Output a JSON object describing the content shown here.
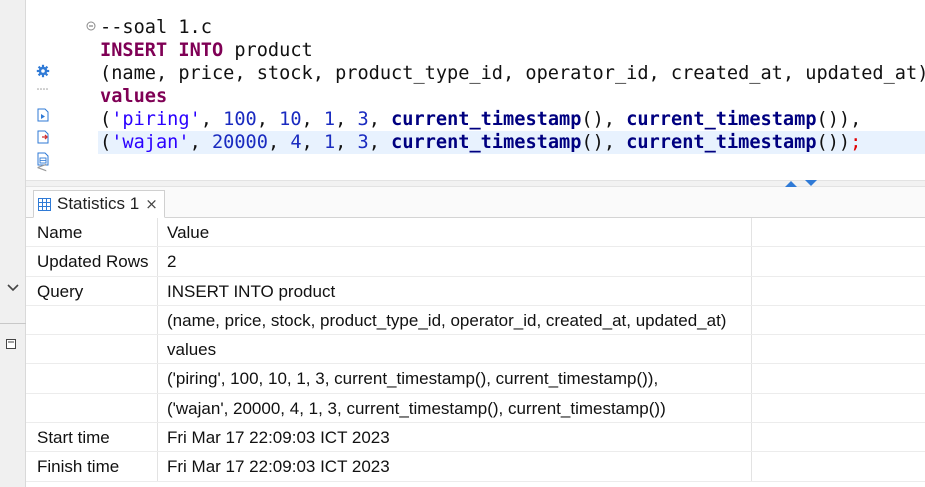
{
  "editor": {
    "code_lines": [
      [
        {
          "t": "--soal 1.c",
          "c": "plain"
        }
      ],
      [
        {
          "t": "INSERT",
          "c": "kw"
        },
        {
          "t": " ",
          "c": "plain"
        },
        {
          "t": "INTO",
          "c": "kw"
        },
        {
          "t": " product",
          "c": "plain"
        }
      ],
      [
        {
          "t": "(name, price, stock, product_type_id, operator_id, created_at, updated_at)",
          "c": "plain"
        }
      ],
      [
        {
          "t": "values",
          "c": "kw"
        }
      ],
      [
        {
          "t": "(",
          "c": "plain"
        },
        {
          "t": "'piring'",
          "c": "str"
        },
        {
          "t": ", ",
          "c": "plain"
        },
        {
          "t": "100",
          "c": "num"
        },
        {
          "t": ", ",
          "c": "plain"
        },
        {
          "t": "10",
          "c": "num"
        },
        {
          "t": ", ",
          "c": "plain"
        },
        {
          "t": "1",
          "c": "num"
        },
        {
          "t": ", ",
          "c": "plain"
        },
        {
          "t": "3",
          "c": "num"
        },
        {
          "t": ", ",
          "c": "plain"
        },
        {
          "t": "current_timestamp",
          "c": "fn"
        },
        {
          "t": "(), ",
          "c": "plain"
        },
        {
          "t": "current_timestamp",
          "c": "fn"
        },
        {
          "t": "()),",
          "c": "plain"
        }
      ],
      [
        {
          "t": "(",
          "c": "plain"
        },
        {
          "t": "'wajan'",
          "c": "str"
        },
        {
          "t": ", ",
          "c": "plain"
        },
        {
          "t": "20000",
          "c": "num"
        },
        {
          "t": ", ",
          "c": "plain"
        },
        {
          "t": "4",
          "c": "num"
        },
        {
          "t": ", ",
          "c": "plain"
        },
        {
          "t": "1",
          "c": "num"
        },
        {
          "t": ", ",
          "c": "plain"
        },
        {
          "t": "3",
          "c": "num"
        },
        {
          "t": ", ",
          "c": "plain"
        },
        {
          "t": "current_timestamp",
          "c": "fn"
        },
        {
          "t": "(), ",
          "c": "plain"
        },
        {
          "t": "current_timestamp",
          "c": "fn"
        },
        {
          "t": "())",
          "c": "plain"
        },
        {
          "t": ";",
          "c": "semi"
        }
      ]
    ],
    "current_line_index": 5,
    "scroll_left_glyph": "<"
  },
  "results": {
    "tab_label": "Statistics 1",
    "tab_close_glyph": "×",
    "header": {
      "name": "Name",
      "value": "Value"
    },
    "rows": [
      {
        "name": "Updated Rows",
        "value": "2"
      },
      {
        "name": "Query",
        "value": "INSERT INTO product"
      },
      {
        "name": "",
        "value": "(name, price, stock, product_type_id, operator_id, created_at, updated_at)"
      },
      {
        "name": "",
        "value": "values"
      },
      {
        "name": "",
        "value": "('piring', 100, 10, 1, 3, current_timestamp(), current_timestamp()),"
      },
      {
        "name": "",
        "value": "('wajan', 20000, 4, 1, 3, current_timestamp(), current_timestamp())"
      },
      {
        "name": "Start time",
        "value": "Fri Mar 17 22:09:03 ICT 2023"
      },
      {
        "name": "Finish time",
        "value": "Fri Mar 17 22:09:03 ICT 2023"
      }
    ]
  },
  "icons": {
    "gutter": [
      "gear-icon",
      "dotted-separator-icon",
      "execute-script-icon",
      "export-script-icon",
      "data-file-icon"
    ],
    "outer": [
      "chevron-down-icon",
      "restore-icon"
    ],
    "tab": "table-grid-icon"
  },
  "colors": {
    "keyword": "#7f0055",
    "string": "#2a00ff",
    "number": "#1a2bc0",
    "function": "#000080",
    "current_line": "#e8f2fe",
    "accent": "#2f7ad6"
  }
}
